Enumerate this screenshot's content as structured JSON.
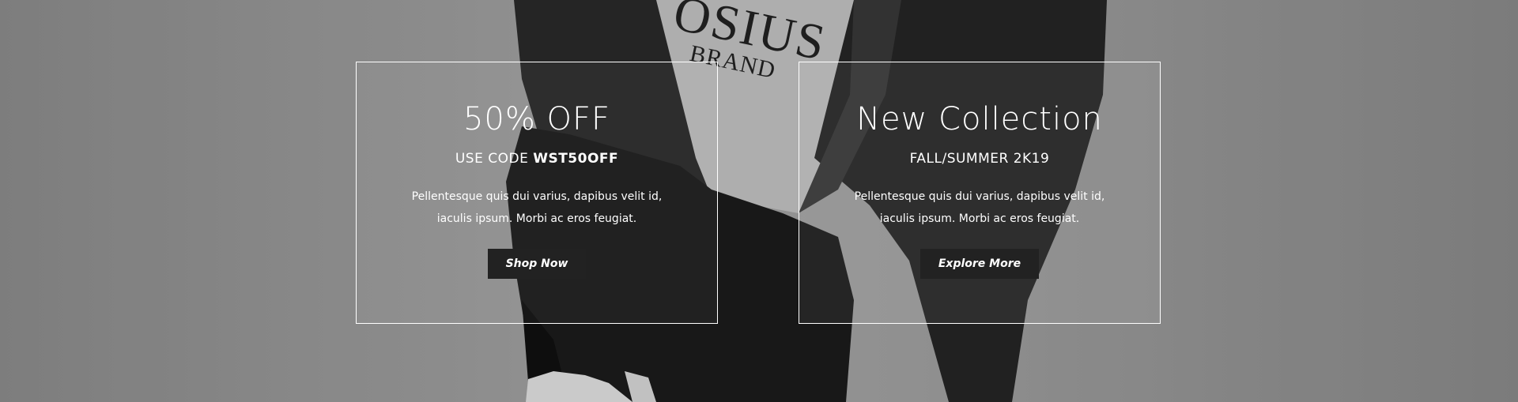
{
  "background": {
    "brand_text_line1": "OSIUS",
    "brand_text_line2": "BRAND",
    "tone": "grayscale"
  },
  "promo_cards": [
    {
      "title": "50% OFF",
      "subtitle_prefix": "USE CODE ",
      "subtitle_code": "WST50OFF",
      "text_line1": "Pellentesque quis dui varius, dapibus velit id,",
      "text_line2": "iaculis ipsum. Morbi ac eros feugiat.",
      "button_label": "Shop Now"
    },
    {
      "title": "New Collection",
      "subtitle": "FALL/SUMMER 2K19",
      "text_line1": "Pellentesque quis dui varius, dapibus velit id,",
      "text_line2": "iaculis ipsum. Morbi ac eros feugiat.",
      "button_label": "Explore More"
    }
  ],
  "colors": {
    "button_bg": "#222222",
    "text": "#ffffff",
    "border": "#ffffff"
  }
}
